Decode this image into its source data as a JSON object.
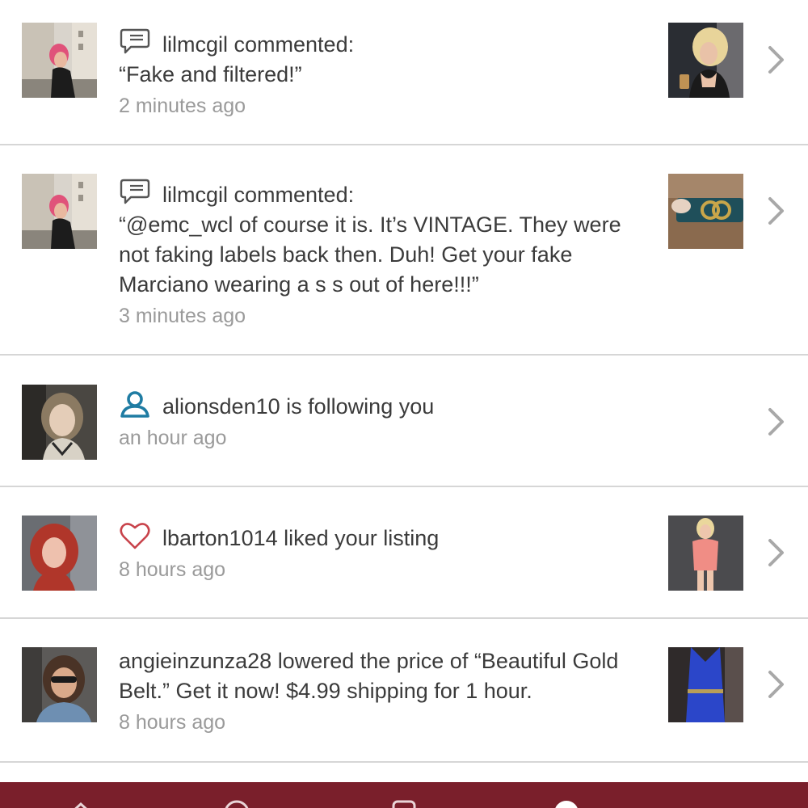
{
  "notifications": [
    {
      "type": "comment",
      "icon": "comment-icon",
      "username": "lilmcgil",
      "action": "commented:",
      "quote": "“Fake and filtered!”",
      "time": "2 minutes ago",
      "has_thumbnail": true
    },
    {
      "type": "comment",
      "icon": "comment-icon",
      "username": "lilmcgil",
      "action": "commented:",
      "quote": "“@emc_wcl of course it is. It’s VINTAGE. They were not faking labels back then. Duh! Get your fake Marciano wearing a s s out of here!!!”",
      "time": "3 minutes ago",
      "has_thumbnail": true
    },
    {
      "type": "follow",
      "icon": "user-icon",
      "username": "alionsden10",
      "action": "is following you",
      "time": "an hour ago",
      "has_thumbnail": false
    },
    {
      "type": "like",
      "icon": "heart-icon",
      "username": "lbarton1014",
      "action": "liked your listing",
      "time": "8 hours ago",
      "has_thumbnail": true
    },
    {
      "type": "price_drop",
      "icon": "",
      "username": "angieinzunza28",
      "action": "lowered the price of “Beautiful Gold Belt.” Get it now! $4.99 shipping for 1 hour.",
      "time": "8 hours ago",
      "has_thumbnail": true
    }
  ],
  "colors": {
    "text": "#3b3b3b",
    "muted": "#9a9a9a",
    "follow_icon": "#1f7ca3",
    "heart_icon": "#c8424a",
    "comment_icon": "#555555",
    "chevron": "#a8a8a8",
    "tabbar": "#7a1f2b",
    "divider": "#d6d6d6"
  }
}
